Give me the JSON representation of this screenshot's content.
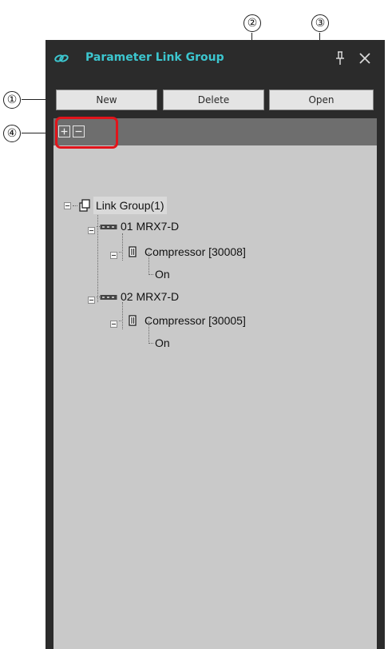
{
  "callouts": [
    "①",
    "②",
    "③",
    "④"
  ],
  "panel": {
    "title": "Parameter Link Group",
    "title_color": "#3cc6cf",
    "title_icon": "link-icon",
    "pin_icon": "pin-icon",
    "close_icon": "close-icon"
  },
  "toolbar": {
    "new_label": "New",
    "delete_label": "Delete",
    "open_label": "Open"
  },
  "expand_bar": {
    "expand_all_icon": "plus-box-icon",
    "collapse_all_icon": "minus-box-icon"
  },
  "tree": {
    "root": "Link Group(1)",
    "devices": [
      {
        "label": "01 MRX7-D",
        "component": "Compressor [30008]",
        "parameter": "On"
      },
      {
        "label": "02 MRX7-D",
        "component": "Compressor [30005]",
        "parameter": "On"
      }
    ]
  },
  "colors": {
    "panel_bg": "#2b2b2b",
    "tree_bg": "#c9c9c9",
    "highlight": "#e1141b"
  }
}
